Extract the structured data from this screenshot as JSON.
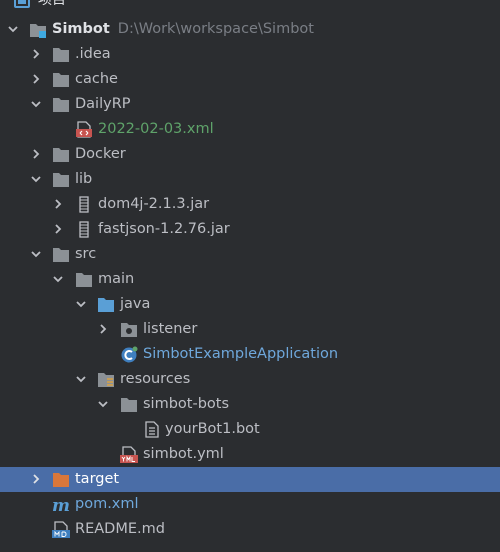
{
  "panel": {
    "title": "项目"
  },
  "tree": {
    "root": {
      "name": "Simbot",
      "path": "D:\\Work\\workspace\\Simbot"
    },
    "idea": ".idea",
    "cache": "cache",
    "dailyrp": "DailyRP",
    "dailyrp_file": "2022-02-03.xml",
    "docker": "Docker",
    "lib": "lib",
    "lib_dom4j": "dom4j-2.1.3.jar",
    "lib_fastjson": "fastjson-1.2.76.jar",
    "src": "src",
    "main": "main",
    "java": "java",
    "listener": "listener",
    "app_class": "SimbotExampleApplication",
    "resources": "resources",
    "simbot_bots": "simbot-bots",
    "yourbot": "yourBot1.bot",
    "simbot_yml": "simbot.yml",
    "target": "target",
    "pom": "pom.xml",
    "readme": "README.md"
  },
  "icons": {
    "folder": "folder-icon",
    "source_folder": "source-folder-icon",
    "resources_folder": "resources-folder-icon",
    "excluded_folder": "excluded-folder-icon",
    "package": "package-icon",
    "jar": "jar-icon",
    "xml": "xml-file-icon",
    "bot_file": "text-file-icon",
    "yml": "yml-file-icon",
    "maven": "maven-icon",
    "markdown": "markdown-icon",
    "class": "spring-class-icon"
  },
  "colors": {
    "background": "#2b2d30",
    "selection": "#4a6da7",
    "folder": "#8c9196",
    "source_folder": "#5a9fd6",
    "excluded_folder": "#d9773a",
    "xml_text": "#5fa36a",
    "class_text": "#6fa8dc"
  }
}
